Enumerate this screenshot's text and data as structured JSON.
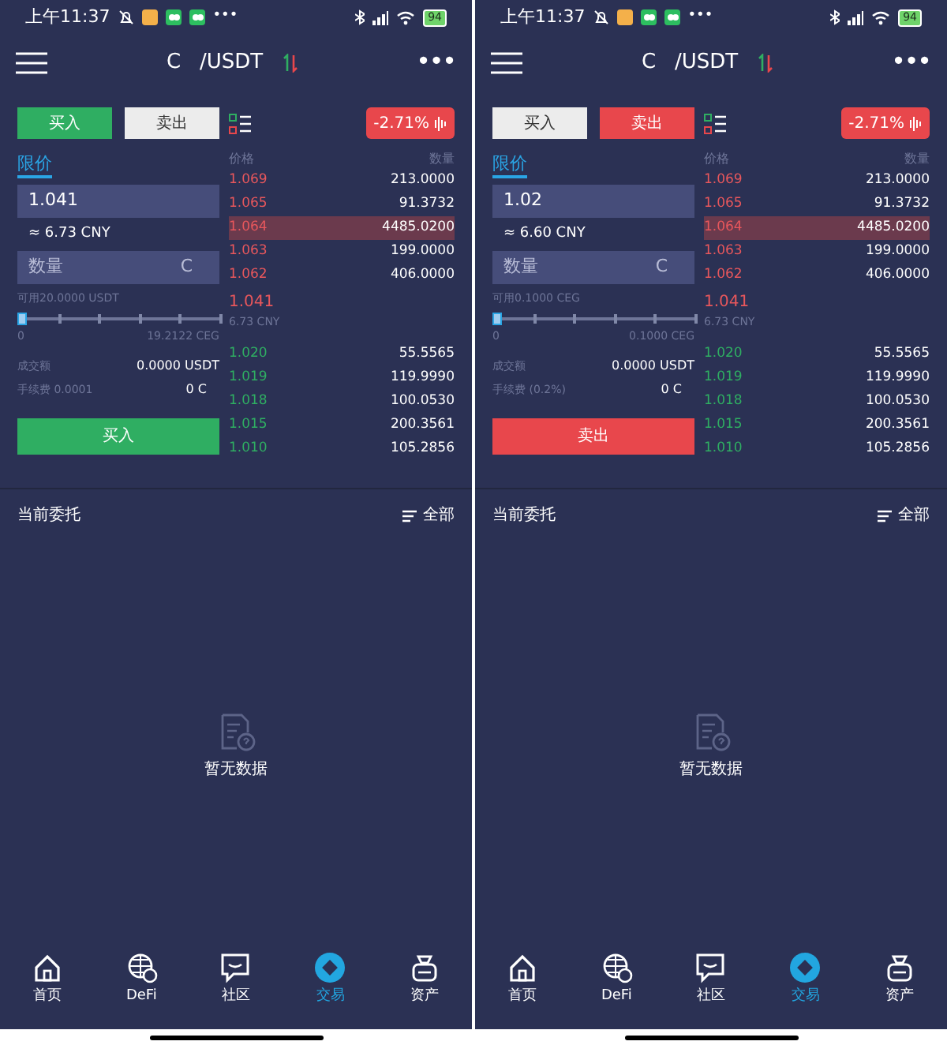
{
  "screens": [
    {
      "status_bar": {
        "time": "上午11:37",
        "more": "•••",
        "battery": "94"
      },
      "header": {
        "pair_start": "C",
        "pair_end": "/USDT",
        "more": "•••"
      },
      "side_tabs": [
        {
          "label": "买入",
          "kind": "buy",
          "selected": true
        },
        {
          "label": "卖出",
          "kind": "sell",
          "selected": false
        }
      ],
      "order_type": "限价",
      "price": "1.041",
      "price_cny": "≈ 6.73 CNY",
      "quantity_placeholder": "数量",
      "quantity_unit": "C",
      "available": "可用20.0000 USDT",
      "slider": {
        "level": 0,
        "min": "0",
        "max": "19.2122 CEG"
      },
      "turnover_label": "成交额",
      "turnover": "0.0000 USDT",
      "fee_label": "手续费 0.0001",
      "fee": "0 C",
      "action": {
        "label": "买入",
        "kind": "buy"
      },
      "change": "-2.71%",
      "book": {
        "price_header": "价格",
        "amount_header": "数量",
        "asks": [
          {
            "price": "1.069",
            "amount": "213.0000",
            "highlighted": false
          },
          {
            "price": "1.065",
            "amount": "91.3732",
            "highlighted": false
          },
          {
            "price": "1.064",
            "amount": "4485.0200",
            "highlighted": true
          },
          {
            "price": "1.063",
            "amount": "199.0000",
            "highlighted": false
          },
          {
            "price": "1.062",
            "amount": "406.0000",
            "highlighted": false
          }
        ],
        "last_price": "1.041",
        "last_cny": "6.73 CNY",
        "bids": [
          {
            "price": "1.020",
            "amount": "55.5565"
          },
          {
            "price": "1.019",
            "amount": "119.9990"
          },
          {
            "price": "1.018",
            "amount": "100.0530"
          },
          {
            "price": "1.015",
            "amount": "200.3561"
          },
          {
            "price": "1.010",
            "amount": "105.2856"
          }
        ]
      },
      "orders": {
        "title": "当前委托",
        "filter": "全部",
        "empty": "暂无数据"
      },
      "nav": [
        {
          "label": "首页",
          "kind": "home",
          "selected": false
        },
        {
          "label": "DeFi",
          "kind": "defi",
          "selected": false
        },
        {
          "label": "社区",
          "kind": "community",
          "selected": false
        },
        {
          "label": "交易",
          "kind": "trade",
          "selected": true
        },
        {
          "label": "资产",
          "kind": "assets",
          "selected": false
        }
      ]
    },
    {
      "status_bar": {
        "time": "上午11:37",
        "more": "•••",
        "battery": "94"
      },
      "header": {
        "pair_start": "C",
        "pair_end": "/USDT",
        "more": "•••"
      },
      "side_tabs": [
        {
          "label": "买入",
          "kind": "buy",
          "selected": false
        },
        {
          "label": "卖出",
          "kind": "sell",
          "selected": true
        }
      ],
      "order_type": "限价",
      "price": "1.02",
      "price_cny": "≈ 6.60 CNY",
      "quantity_placeholder": "数量",
      "quantity_unit": "C",
      "available": "可用0.1000 CEG",
      "slider": {
        "level": 0,
        "min": "0",
        "max": "0.1000 CEG"
      },
      "turnover_label": "成交额",
      "turnover": "0.0000 USDT",
      "fee_label": "手续费 (0.2%)",
      "fee": "0 C",
      "action": {
        "label": "卖出",
        "kind": "sell"
      },
      "change": "-2.71%",
      "book": {
        "price_header": "价格",
        "amount_header": "数量",
        "asks": [
          {
            "price": "1.069",
            "amount": "213.0000",
            "highlighted": false
          },
          {
            "price": "1.065",
            "amount": "91.3732",
            "highlighted": false
          },
          {
            "price": "1.064",
            "amount": "4485.0200",
            "highlighted": true
          },
          {
            "price": "1.063",
            "amount": "199.0000",
            "highlighted": false
          },
          {
            "price": "1.062",
            "amount": "406.0000",
            "highlighted": false
          }
        ],
        "last_price": "1.041",
        "last_cny": "6.73 CNY",
        "bids": [
          {
            "price": "1.020",
            "amount": "55.5565"
          },
          {
            "price": "1.019",
            "amount": "119.9990"
          },
          {
            "price": "1.018",
            "amount": "100.0530"
          },
          {
            "price": "1.015",
            "amount": "200.3561"
          },
          {
            "price": "1.010",
            "amount": "105.2856"
          }
        ]
      },
      "orders": {
        "title": "当前委托",
        "filter": "全部",
        "empty": "暂无数据"
      },
      "nav": [
        {
          "label": "首页",
          "kind": "home",
          "selected": false
        },
        {
          "label": "DeFi",
          "kind": "defi",
          "selected": false
        },
        {
          "label": "社区",
          "kind": "community",
          "selected": false
        },
        {
          "label": "交易",
          "kind": "trade",
          "selected": true
        },
        {
          "label": "资产",
          "kind": "assets",
          "selected": false
        }
      ]
    }
  ]
}
